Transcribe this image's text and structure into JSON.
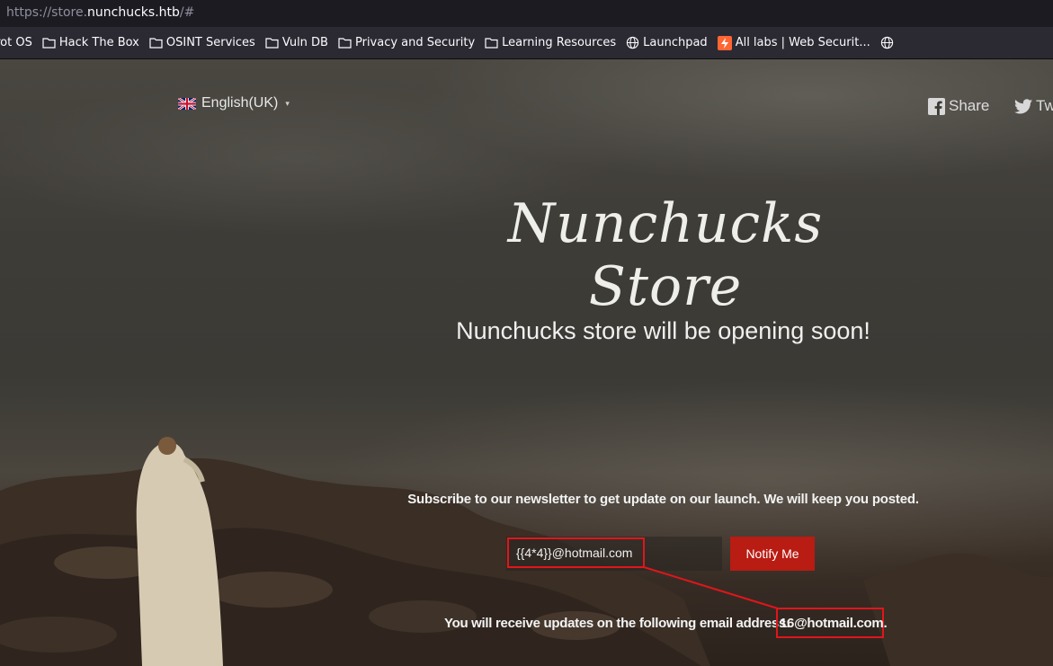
{
  "browser": {
    "url_prefix": "https://store.",
    "url_host": "nunchucks.htb",
    "url_suffix": "/#",
    "bookmarks": [
      {
        "label": "rrot OS",
        "icon": "none"
      },
      {
        "label": "Hack The Box",
        "icon": "folder-icon"
      },
      {
        "label": "OSINT Services",
        "icon": "folder-icon"
      },
      {
        "label": "Vuln DB",
        "icon": "folder-icon"
      },
      {
        "label": "Privacy and Security",
        "icon": "folder-icon"
      },
      {
        "label": "Learning Resources",
        "icon": "folder-icon"
      },
      {
        "label": "Launchpad",
        "icon": "globe-icon"
      },
      {
        "label": "All labs | Web Securit...",
        "icon": "portswigger-icon"
      }
    ]
  },
  "header": {
    "language": "English(UK)",
    "share": "Share",
    "tweet": "Tw"
  },
  "hero": {
    "title": "Nunchucks Store",
    "subtitle": "Nunchucks store will be opening soon!"
  },
  "newsletter": {
    "text": "Subscribe to our newsletter to get update on our launch. We will keep you posted.",
    "email_value": "{{4*4}}@hotmail.com",
    "button": "Notify Me",
    "result_text": "You will receive updates on the following email address:",
    "result_value": "16@hotmail.com."
  },
  "colors": {
    "accent_red": "#b81c13",
    "highlight_red": "#e0161b"
  }
}
